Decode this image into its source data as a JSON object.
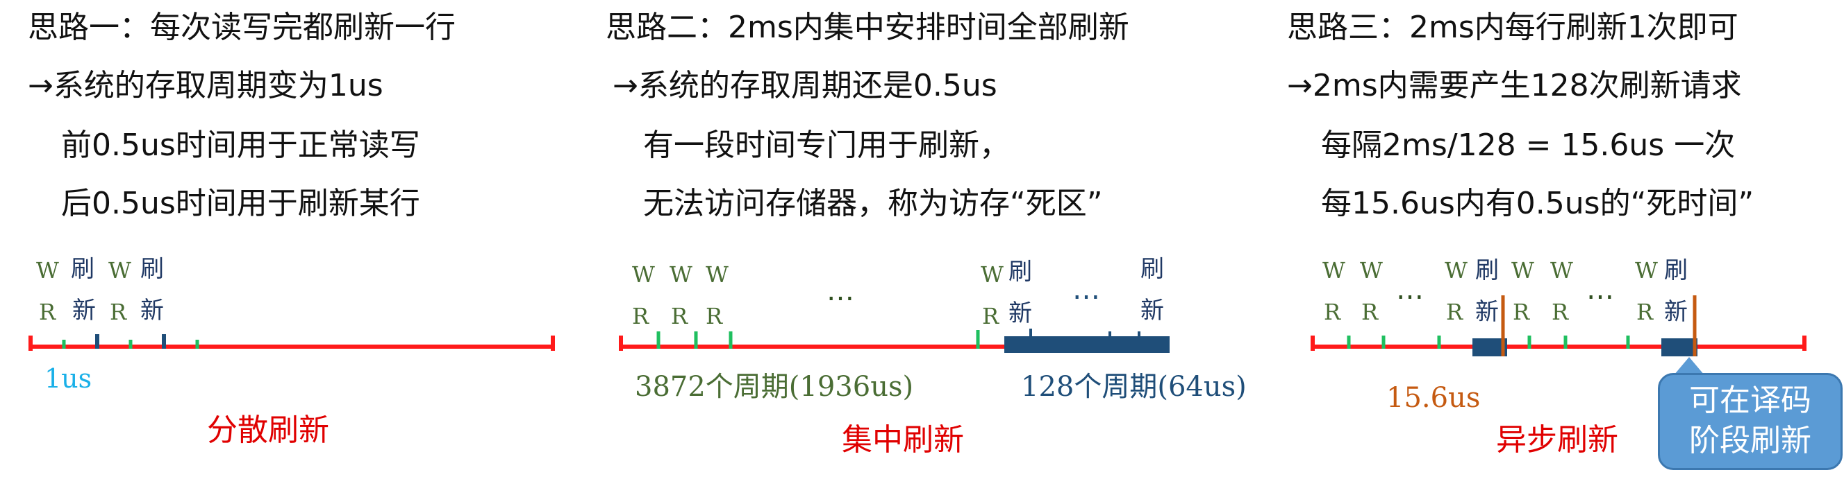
{
  "col1": {
    "line1": "思路一：每次读写完都刷新一行",
    "line2": "→系统的存取周期变为1us",
    "line3": "前0.5us时间用于正常读写",
    "line4": "后0.5us时间用于刷新某行",
    "w": "W",
    "r": "R",
    "shua": "刷",
    "xin": "新",
    "unit_label": "1us",
    "caption": "分散刷新"
  },
  "col2": {
    "line1": "思路二：2ms内集中安排时间全部刷新",
    "line2": "→系统的存取周期还是0.5us",
    "line3": "有一段时间专门用于刷新，",
    "line4": "无法访问存储器，称为访存“死区”",
    "w": "W",
    "r": "R",
    "shua": "刷",
    "xin": "新",
    "dots": "…",
    "period_normal": "3872个周期(1936us)",
    "period_refresh": "128个周期(64us)",
    "caption": "集中刷新"
  },
  "col3": {
    "line1": "思路三：2ms内每行刷新1次即可",
    "line2": "→2ms内需要产生128次刷新请求",
    "line3": "每隔2ms/128 = 15.6us 一次",
    "line4": "每15.6us内有0.5us的“死时间”",
    "w": "W",
    "r": "R",
    "shua": "刷",
    "xin": "新",
    "dots": "…",
    "interval_label": "15.6us",
    "caption": "异步刷新",
    "callout_line1": "可在译码",
    "callout_line2": "阶段刷新"
  },
  "colors": {
    "axis": "#ff1a1a",
    "rw_tick": "#1fbf5f",
    "refresh_block": "#1f4e79",
    "label_green": "#4a6d34",
    "label_cyan": "#1ab0e8",
    "label_orange": "#c55a11",
    "caption_red": "#e00000",
    "callout": "#5b9bd5"
  }
}
